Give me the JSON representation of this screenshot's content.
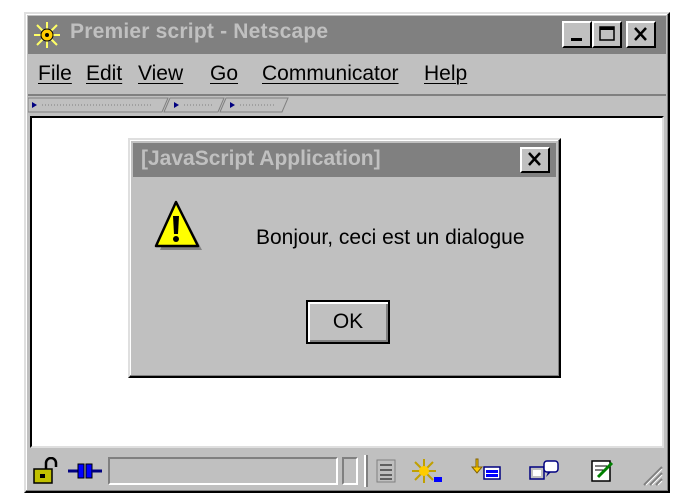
{
  "window": {
    "title": "Premier script - Netscape",
    "icons": {
      "app": "netscape-icon",
      "minimize": "minimize-icon",
      "maximize": "maximize-icon",
      "close": "close-icon"
    }
  },
  "menu": {
    "items": [
      {
        "label": "File",
        "name": "menu-file"
      },
      {
        "label": "Edit",
        "name": "menu-edit"
      },
      {
        "label": "View",
        "name": "menu-view"
      },
      {
        "label": "Go",
        "name": "menu-go"
      },
      {
        "label": "Communicator",
        "name": "menu-communicator"
      },
      {
        "label": "Help",
        "name": "menu-help"
      }
    ]
  },
  "dialog": {
    "title": "[JavaScript Application]",
    "message": "Bonjour, ceci est un dialogue",
    "ok_label": "OK",
    "icon": "warning-icon"
  },
  "statusbar": {
    "icons": [
      "security-lock-icon",
      "connection-plug-icon",
      "navigator-icon",
      "mail-icon",
      "discussion-icon",
      "composer-icon"
    ]
  },
  "colors": {
    "face": "#c0c0c0",
    "inactive_title": "#808080",
    "warning_yellow": "#ffff00"
  }
}
